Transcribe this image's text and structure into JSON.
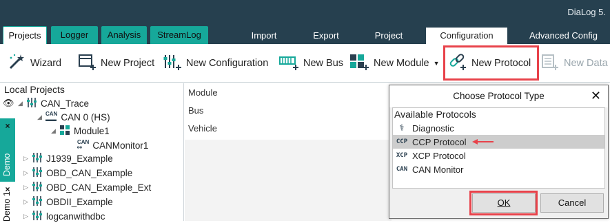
{
  "app_title": "DiaLog 5.",
  "left_tabs": [
    "Projects",
    "Logger",
    "Analysis",
    "StreamLog"
  ],
  "right_tabs": [
    "Import",
    "Export",
    "Project",
    "Configuration",
    "Advanced Config"
  ],
  "ribbon": {
    "wizard": "Wizard",
    "new_project": "New Project",
    "new_configuration": "New Configuration",
    "new_bus": "New Bus",
    "new_module": "New Module",
    "new_protocol": "New Protocol",
    "new_data": "New Data"
  },
  "panel": {
    "title": "Local Projects",
    "vtab1": {
      "close": "×",
      "label": "Demo"
    },
    "vtab2": {
      "close": "×",
      "label": "Demo 1"
    },
    "tree": [
      {
        "label": "CAN_Trace"
      },
      {
        "label": "CAN 0 (HS)"
      },
      {
        "label": "Module1"
      },
      {
        "label": "CANMonitor1"
      },
      {
        "label": "J1939_Example"
      },
      {
        "label": "OBD_CAN_Example"
      },
      {
        "label": "OBD_CAN_Example_Ext"
      },
      {
        "label": "OBDII_Example"
      },
      {
        "label": "logcanwithdbc"
      }
    ]
  },
  "props": [
    "Module",
    "Bus",
    "Vehicle"
  ],
  "dialog": {
    "title": "Choose Protocol Type",
    "close": "✕",
    "list_header": "Available Protocols",
    "items": [
      {
        "label": "Diagnostic"
      },
      {
        "label": "CCP Protocol"
      },
      {
        "label": "XCP Protocol"
      },
      {
        "label": "CAN Monitor"
      }
    ],
    "ok": "OK",
    "cancel": "Cancel"
  },
  "colors": {
    "accent": "#16a89a",
    "header": "#26404f",
    "highlight": "#e8424a"
  }
}
